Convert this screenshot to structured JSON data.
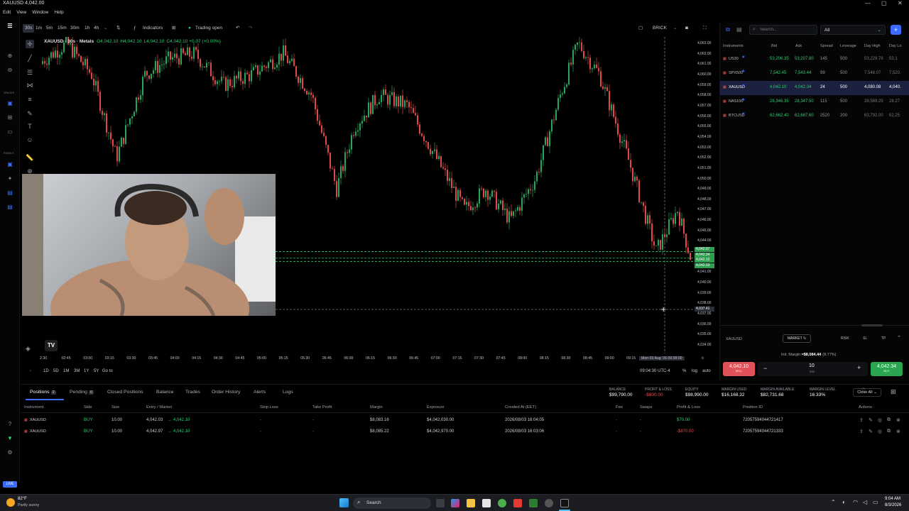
{
  "window": {
    "title": "XAUUSD 4,042.00",
    "controls": {
      "min": "—",
      "max": "▢",
      "close": "✕"
    }
  },
  "menu": [
    "Edit",
    "View",
    "Window",
    "Help"
  ],
  "rail": {
    "spaces_label": "SPACES",
    "panels_label": "PANELS",
    "live": "LIVE"
  },
  "toolbar": {
    "intervals": [
      "30s",
      "1m",
      "5m",
      "15m",
      "30m",
      "1h",
      "4h"
    ],
    "active_interval": "30s",
    "indicators": "Indicators",
    "trading_status": "Trading open",
    "layout_name": "BRICK"
  },
  "chart": {
    "symbol": "XAUUSD · 30s · Metals",
    "ohlc": {
      "o": "O4,042.10",
      "h": "H4,042.10",
      "l": "L4,042.10",
      "c": "C4,042.10 +0.07 (+0.00%)"
    },
    "price_labels": [
      "4,063.00",
      "4,062.00",
      "4,061.00",
      "4,060.00",
      "4,059.00",
      "4,058.00",
      "4,057.00",
      "4,056.00",
      "4,055.00",
      "4,054.00",
      "4,053.00",
      "4,052.00",
      "4,051.00",
      "4,050.00",
      "4,049.00",
      "4,048.00",
      "4,047.00",
      "4,046.00",
      "4,045.00",
      "4,044.00",
      "4,043.00",
      "4,042.00",
      "4,041.00",
      "4,040.00",
      "4,039.00",
      "4,038.00",
      "4,037.00",
      "4,036.00",
      "4,035.00",
      "4,034.00"
    ],
    "price_tags": [
      "4,042.97",
      "4,042.34",
      "4,042.10",
      "4,042.03"
    ],
    "crosshair_price": "4,037.41",
    "time_labels": [
      "2:30",
      "02:45",
      "03:00",
      "03:15",
      "03:30",
      "03:45",
      "04:00",
      "04:15",
      "04:30",
      "04:45",
      "05:00",
      "05:15",
      "05:30",
      "05:45",
      "06:00",
      "06:15",
      "06:30",
      "06:45",
      "07:00",
      "07:15",
      "07:30",
      "07:45",
      "08:00",
      "08:15",
      "08:30",
      "08:45",
      "09:00",
      "09:15"
    ],
    "crosshair_time": "Mon 03 Aug '26    09:38:00",
    "ranges": [
      "1D",
      "5D",
      "1M",
      "3M",
      "1Y",
      "5Y"
    ],
    "goto": "Go to",
    "clock": "09:04:30 UTC-4",
    "scale_opts": [
      "%",
      "log",
      "auto"
    ],
    "candles_up": "#26a65b",
    "candles_down": "#e04848"
  },
  "right_panel": {
    "search_placeholder": "Search...",
    "filter": "All",
    "headers": [
      "Instruments",
      "Bid",
      "Ask",
      "Spread",
      "Leverage",
      "Day High",
      "Day Lo"
    ],
    "rows": [
      {
        "sym": "US30",
        "bid": "53,206.35",
        "ask": "53,207.80",
        "spread": "145",
        "lev": "500",
        "high": "53,229.78",
        "low": "53,1"
      },
      {
        "sym": "SPX500",
        "bid": "7,542.45",
        "ask": "7,543.44",
        "spread": "99",
        "lev": "500",
        "high": "7,548.07",
        "low": "7,520."
      },
      {
        "sym": "XAUUSD",
        "bid": "4,042.10",
        "ask": "4,042.34",
        "spread": "24",
        "lev": "500",
        "high": "4,080.08",
        "low": "4,040."
      },
      {
        "sym": "NAS100",
        "bid": "28,346.35",
        "ask": "28,347.50",
        "spread": "115",
        "lev": "500",
        "high": "28,589.25",
        "low": "28,27"
      },
      {
        "sym": "BTCUSD",
        "bid": "62,662.40",
        "ask": "62,687.60",
        "spread": "2520",
        "lev": "200",
        "high": "63,792.00",
        "low": "62,25"
      }
    ],
    "order": {
      "symbol": "XAUUSD",
      "type": "MARKET",
      "btns": [
        "RISK",
        "SL",
        "TP"
      ],
      "margin_label": "Init. Margin: ",
      "margin_value": "≈$8,084.44",
      "margin_pct": "(8.77%)",
      "sell_price": "4,042.10",
      "sell_label": "SELL",
      "buy_price": "4,042.34",
      "buy_label": "BUY",
      "lots": "10",
      "lots_label": "lots",
      "minus": "−",
      "plus": "+"
    }
  },
  "positions": {
    "tabs": [
      {
        "label": "Positions",
        "badge": "2"
      },
      {
        "label": "Pending",
        "badge": "0"
      },
      {
        "label": "Closed Positions",
        "badge": ""
      },
      {
        "label": "Balance",
        "badge": ""
      },
      {
        "label": "Trades",
        "badge": ""
      },
      {
        "label": "Order History",
        "badge": ""
      },
      {
        "label": "Alerts",
        "badge": ""
      },
      {
        "label": "Logs",
        "badge": ""
      }
    ],
    "summary": [
      {
        "label": "BALANCE",
        "value": "$99,790.00",
        "neg": false
      },
      {
        "label": "PROFIT & LOSS",
        "value": "-$800.00",
        "neg": true
      },
      {
        "label": "EQUITY",
        "value": "$98,990.00",
        "neg": false
      },
      {
        "label": "MARGIN USED",
        "value": "$16,168.32",
        "neg": false
      },
      {
        "label": "MARGIN AVAILABLE",
        "value": "$82,731.68",
        "neg": false
      },
      {
        "label": "MARGIN LEVEL",
        "value": "16.33%",
        "neg": false
      }
    ],
    "close_all": "Close All",
    "columns": [
      "Instrument",
      "Side",
      "Size",
      "Entry / Market",
      "Stop Loss",
      "Take Profit",
      "Margin",
      "Exposure",
      "Created At (EET)",
      "Fee",
      "Swaps",
      "Profit & Loss",
      "Position ID",
      "Actions"
    ],
    "rows": [
      {
        "inst": "XAUUSD",
        "side": "BUY",
        "size": "10.00",
        "entry": "4,042.03",
        "market": "4,042.10",
        "sl": "-",
        "tp": "-",
        "margin": "$8,083.16",
        "exposure": "$4,042,030.00",
        "created": "2026/08/03 16:04:05",
        "fee": "-",
        "swaps": "-",
        "pnl": "$70.00",
        "pnl_neg": false,
        "id": "72057594044721417"
      },
      {
        "inst": "XAUUSD",
        "side": "BUY",
        "size": "10.00",
        "entry": "4,042.97",
        "market": "4,042.10",
        "sl": "-",
        "tp": "-",
        "margin": "$8,085.22",
        "exposure": "$4,042,970.00",
        "created": "2026/08/03 16:03:06",
        "fee": "-",
        "swaps": "-",
        "pnl": "-$870.00",
        "pnl_neg": true,
        "id": "72057594044721333"
      }
    ]
  },
  "taskbar": {
    "weather_temp": "82°F",
    "weather_desc": "Partly sunny",
    "search": "Search",
    "time": "9:04 AM",
    "date": "8/3/2026"
  }
}
